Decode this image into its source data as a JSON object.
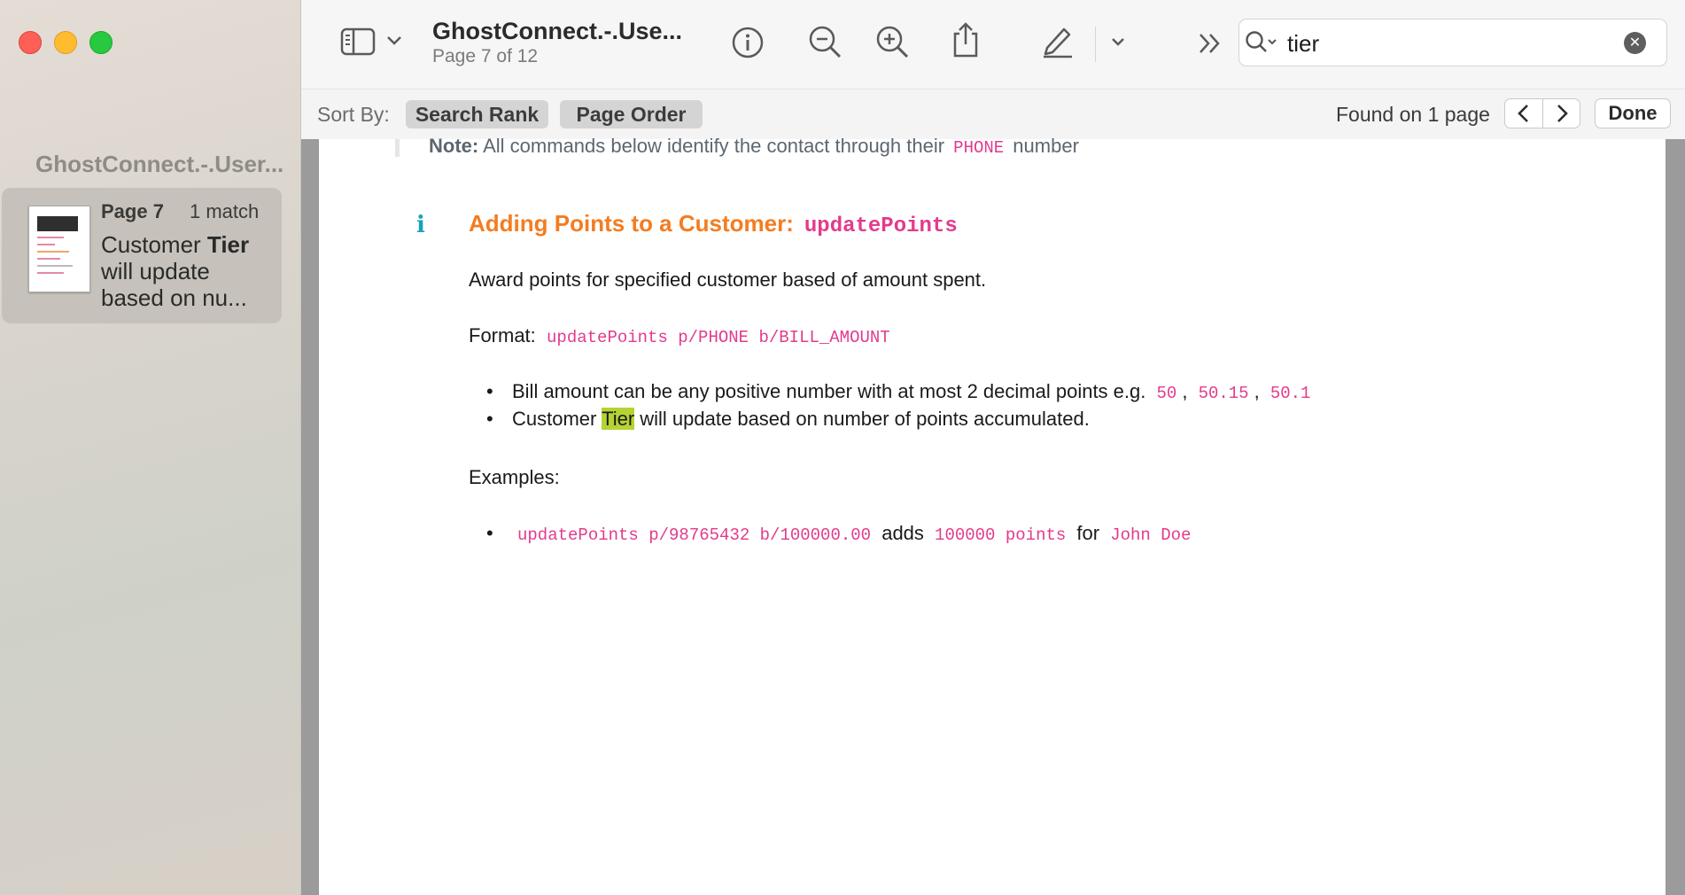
{
  "sidebar": {
    "doc_title": "GhostConnect.-.User...",
    "result": {
      "page_label": "Page 7",
      "match_count": "1 match",
      "snippet_prefix": "Customer ",
      "snippet_match": "Tier",
      "snippet_suffix": " will update based on nu..."
    }
  },
  "toolbar": {
    "doc_title": "GhostConnect.-.Use...",
    "page_info": "Page 7 of 12",
    "icons": [
      "sidebar-toggle-icon",
      "chevron-down-icon",
      "info-icon",
      "zoom-out-icon",
      "zoom-in-icon",
      "share-icon",
      "markup-pen-icon",
      "chevron-down-icon",
      "more-chevrons-icon",
      "search-icon"
    ],
    "search_value": "tier"
  },
  "findbar": {
    "sort_label": "Sort By:",
    "sort_options": [
      "Search Rank",
      "Page Order"
    ],
    "found_text": "Found on 1 page",
    "done_label": "Done"
  },
  "document": {
    "note_label": "Note:",
    "note_text": " All commands below identify the contact through their ",
    "note_code": "PHONE",
    "note_suffix": " number",
    "info_glyph": "i",
    "heading_text": "Adding Points to a Customer:",
    "heading_code": "updatePoints",
    "description": "Award points for specified customer based of amount spent.",
    "format_label": "Format:",
    "format_code": "updatePoints p/PHONE b/BILL_AMOUNT",
    "bullet1_text": "Bill amount can be any positive number with at most 2 decimal points e.g.",
    "bullet1_codes": [
      "50",
      "50.15",
      "50.1"
    ],
    "bullet1_sep": ",",
    "bullet2_prefix": "Customer ",
    "bullet2_match": "Tier",
    "bullet2_suffix": " will update based on number of points accumulated.",
    "examples_label": "Examples:",
    "example_code": "updatePoints p/98765432 b/100000.00",
    "example_adds": "adds",
    "example_points": "100000 points",
    "example_for": "for",
    "example_name": "John Doe"
  },
  "colors": {
    "heading": "#f47c20",
    "code": "#e23b8d",
    "highlight": "#b5d333",
    "info": "#17a2b8"
  }
}
